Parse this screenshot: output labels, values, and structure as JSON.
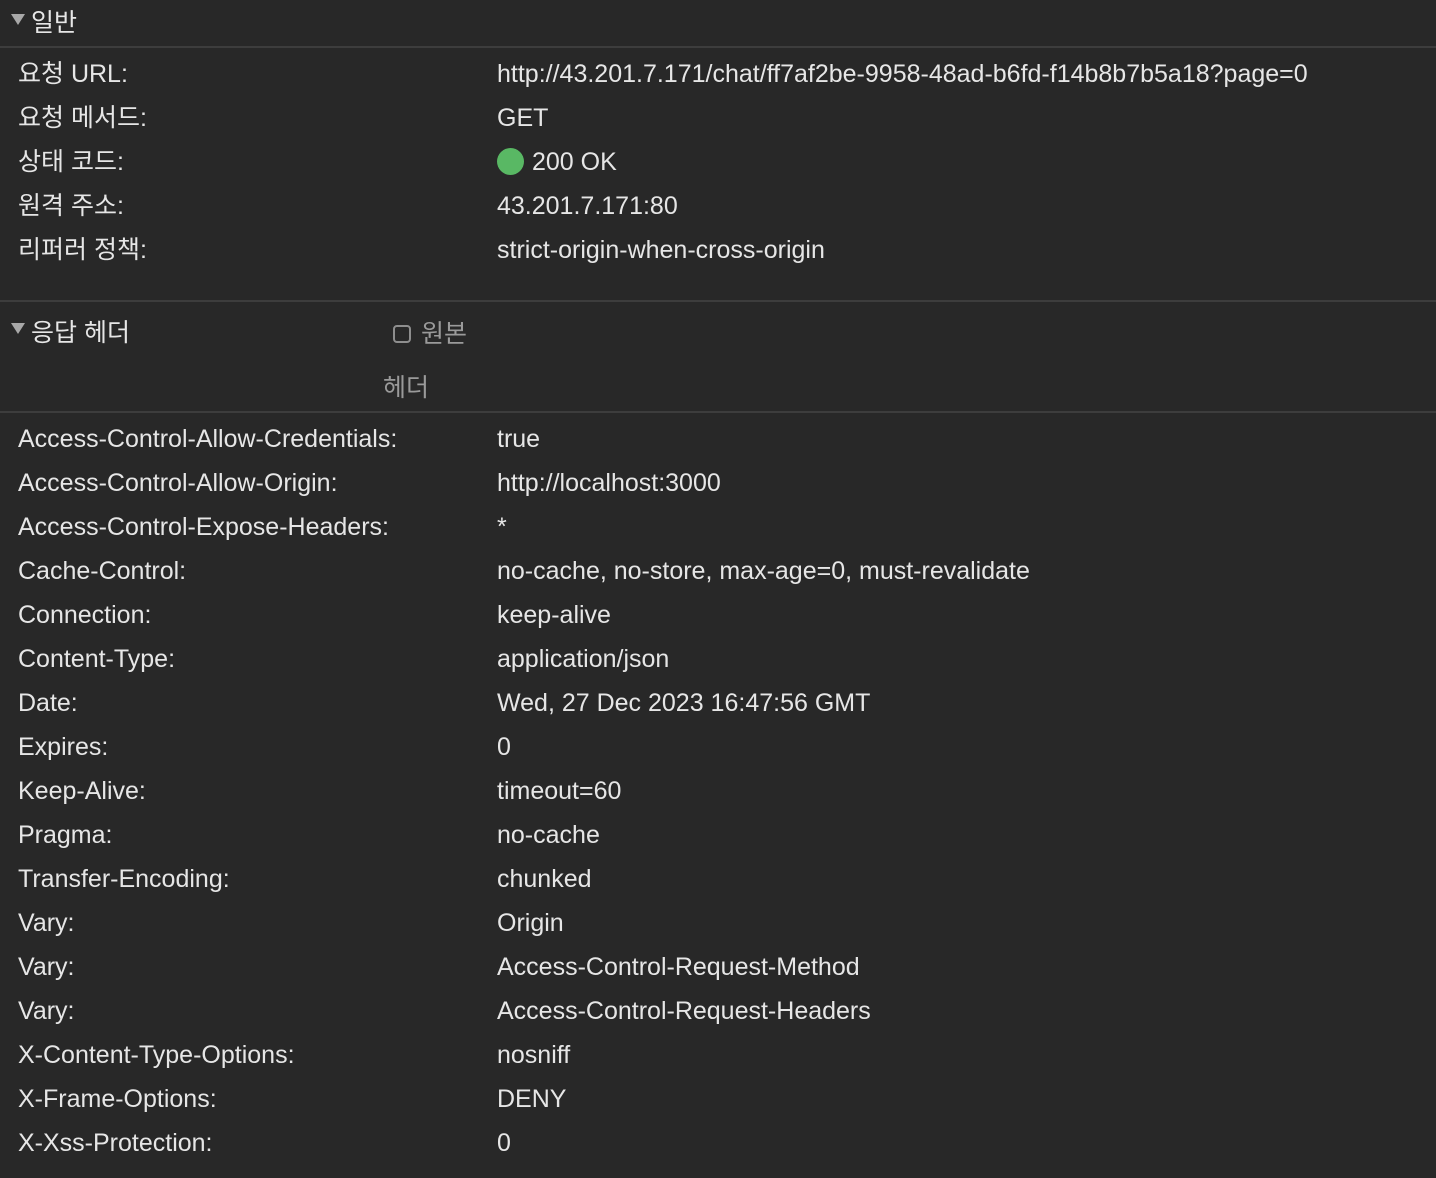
{
  "general": {
    "title": "일반",
    "rows": [
      {
        "key": "요청 URL:",
        "value": "http://43.201.7.171/chat/ff7af2be-9958-48ad-b6fd-f14b8b7b5a18?page=0"
      },
      {
        "key": "요청 메서드:",
        "value": "GET"
      },
      {
        "key": "상태 코드:",
        "value": "200 OK"
      },
      {
        "key": "원격 주소:",
        "value": "43.201.7.171:80"
      },
      {
        "key": "리퍼러 정책:",
        "value": "strict-origin-when-cross-origin"
      }
    ],
    "status_color": "#59b864"
  },
  "response_headers": {
    "title": "응답 헤더",
    "raw_label_line1": "원본",
    "raw_label_line2": "헤더",
    "raw_checked": false,
    "rows": [
      {
        "key": "Access-Control-Allow-Credentials:",
        "value": "true"
      },
      {
        "key": "Access-Control-Allow-Origin:",
        "value": "http://localhost:3000"
      },
      {
        "key": "Access-Control-Expose-Headers:",
        "value": "*"
      },
      {
        "key": "Cache-Control:",
        "value": "no-cache, no-store, max-age=0, must-revalidate"
      },
      {
        "key": "Connection:",
        "value": "keep-alive"
      },
      {
        "key": "Content-Type:",
        "value": "application/json"
      },
      {
        "key": "Date:",
        "value": "Wed, 27 Dec 2023 16:47:56 GMT"
      },
      {
        "key": "Expires:",
        "value": "0"
      },
      {
        "key": "Keep-Alive:",
        "value": "timeout=60"
      },
      {
        "key": "Pragma:",
        "value": "no-cache"
      },
      {
        "key": "Transfer-Encoding:",
        "value": "chunked"
      },
      {
        "key": "Vary:",
        "value": "Origin"
      },
      {
        "key": "Vary:",
        "value": "Access-Control-Request-Method"
      },
      {
        "key": "Vary:",
        "value": "Access-Control-Request-Headers"
      },
      {
        "key": "X-Content-Type-Options:",
        "value": "nosniff"
      },
      {
        "key": "X-Frame-Options:",
        "value": "DENY"
      },
      {
        "key": "X-Xss-Protection:",
        "value": "0"
      }
    ]
  }
}
